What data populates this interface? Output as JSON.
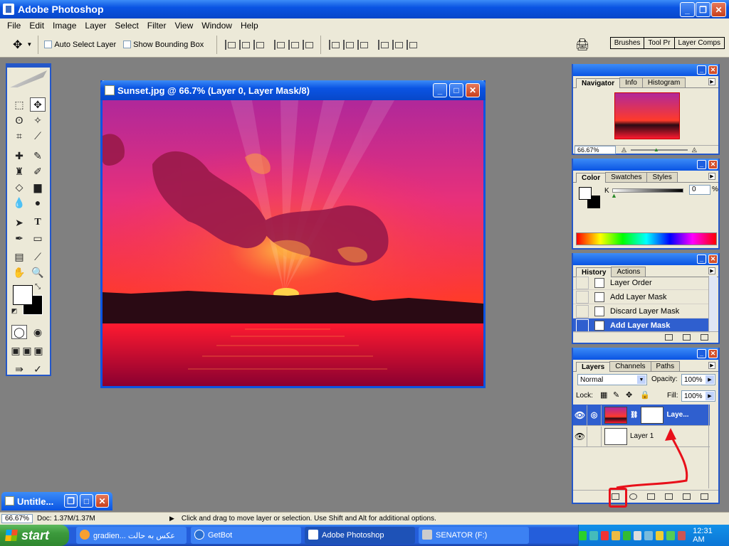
{
  "app": {
    "title": "Adobe Photoshop"
  },
  "menu": [
    "File",
    "Edit",
    "Image",
    "Layer",
    "Select",
    "Filter",
    "View",
    "Window",
    "Help"
  ],
  "options": {
    "auto_select": "Auto Select Layer",
    "show_bbox": "Show Bounding Box",
    "wells": [
      "Brushes",
      "Tool Pr",
      "Layer Comps"
    ]
  },
  "document": {
    "title": "Sunset.jpg @ 66.7% (Layer 0, Layer Mask/8)"
  },
  "navigator": {
    "tabs": [
      "Navigator",
      "Info",
      "Histogram"
    ],
    "zoom": "66.67%"
  },
  "color": {
    "tabs": [
      "Color",
      "Swatches",
      "Styles"
    ],
    "channel": "K",
    "value": "0",
    "unit": "%"
  },
  "history": {
    "tabs": [
      "History",
      "Actions"
    ],
    "items": [
      "Layer Order",
      "Add Layer Mask",
      "Discard Layer Mask",
      "Add Layer Mask"
    ],
    "active_index": 3
  },
  "layers": {
    "tabs": [
      "Layers",
      "Channels",
      "Paths"
    ],
    "blend_mode": "Normal",
    "opacity_label": "Opacity:",
    "opacity": "100%",
    "lock_label": "Lock:",
    "fill_label": "Fill:",
    "fill": "100%",
    "rows": [
      {
        "name": "Laye..."
      },
      {
        "name": "Layer 1"
      }
    ]
  },
  "minimized_doc": {
    "title": "Untitle..."
  },
  "status": {
    "zoom": "66.67%",
    "doc": "Doc: 1.37M/1.37M",
    "hint": "Click and drag to move layer or selection.  Use Shift and Alt for additional options."
  },
  "taskbar": {
    "start": "start",
    "tasks": [
      "gradien... عکس به حالت",
      "GetBot",
      "Adobe Photoshop",
      "SENATOR (F:)"
    ],
    "clock": "12:31 AM"
  },
  "colors": {
    "accent": "#0a54e3",
    "annotation": "#e8101a"
  }
}
